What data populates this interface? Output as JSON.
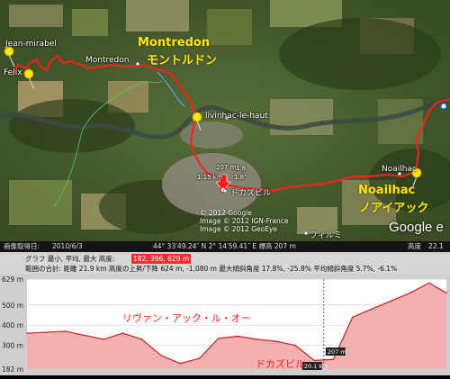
{
  "map": {
    "places": {
      "jean_mirabel": "Jean-mirabel",
      "felix": "Felix",
      "montredon": "Montredon",
      "livinhac": "livinhac-le-haut",
      "noailhac": "Noailhac",
      "decazeville": "ドカズビル",
      "firmi": "フィルミ"
    },
    "annotations": {
      "montredon_latin": "Montredon",
      "montredon_kana": "モントルドン",
      "noailhac_latin": "Noailhac",
      "noailhac_kana": "ノアイアック"
    },
    "marker_labels": {
      "distance": "207 m",
      "dist_small": "1.15 km",
      "angle": "1.8°",
      "angle2": "1.8"
    },
    "attribution": [
      "© 2012 Google",
      "Image © 2012 IGN-France",
      "Image © 2012 GeoEye"
    ],
    "logo": "Google e"
  },
  "statusbar": {
    "date_label": "画像取得日:",
    "date_value": "2010/6/3",
    "coords": "44° 33′49.24″ N   2° 14′59.41″ E  標高   207 m",
    "alt_label": "高度",
    "alt_value": "22.1"
  },
  "profile": {
    "line1": {
      "text": "グラフ 最小, 平均, 最大 高度:",
      "highlight": "182, 396, 629 m"
    },
    "line2": {
      "text": "範囲の合計: 距離 21.9 km  高度の上昇/下降 624 m, -1,080 m 最大傾斜角度 17.8%, -25.8% 平均傾斜角度 5.7%, -6.1%"
    },
    "y_ticks": [
      "629 m",
      "500 m",
      "400 m",
      "300 m",
      "182 m"
    ],
    "annotation": "リヴァン・アック・ル・オー",
    "decazeville": "ドカズビル",
    "cursor_label": "207 m",
    "cursor_label2": "20.1 km",
    "colors": {
      "route": "#ff1f1f",
      "fill": "#f3b0b0",
      "annotation": "#ff1f1f"
    }
  },
  "chart_data": {
    "type": "area",
    "xlabel": "",
    "ylabel": "",
    "ylim": [
      182,
      629
    ],
    "x": [
      0,
      1,
      2,
      3,
      4,
      5,
      6,
      7,
      8,
      9,
      10,
      11,
      12,
      13,
      14,
      15,
      16,
      17,
      18,
      19,
      20,
      21,
      21.9
    ],
    "series": [
      {
        "values": [
          360,
          365,
          370,
          350,
          330,
          360,
          330,
          250,
          210,
          235,
          335,
          345,
          330,
          320,
          300,
          225,
          230,
          440,
          480,
          520,
          560,
          610,
          560
        ]
      }
    ]
  }
}
